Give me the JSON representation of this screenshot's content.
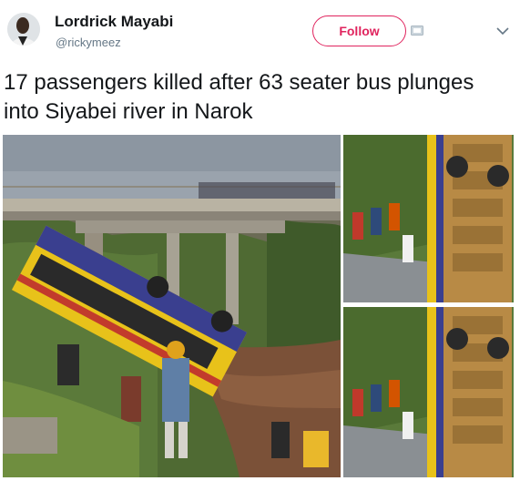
{
  "user": {
    "display_name": "Lordrick Mayabi",
    "handle": "@rickymeez",
    "avatar_icon": "user-avatar"
  },
  "actions": {
    "follow_label": "Follow",
    "block_icon": "block-icon",
    "more_icon": "chevron-down-icon"
  },
  "tweet": {
    "text": "17 passengers killed after 63 seater bus plunges into Siyabei river in Narok"
  },
  "media": {
    "count": 3
  },
  "colors": {
    "follow_accent": "#e0245e",
    "handle_gray": "#657786",
    "text": "#14171a",
    "bus_yellow": "#e8c21a",
    "bus_blue": "#3a3f8f"
  }
}
